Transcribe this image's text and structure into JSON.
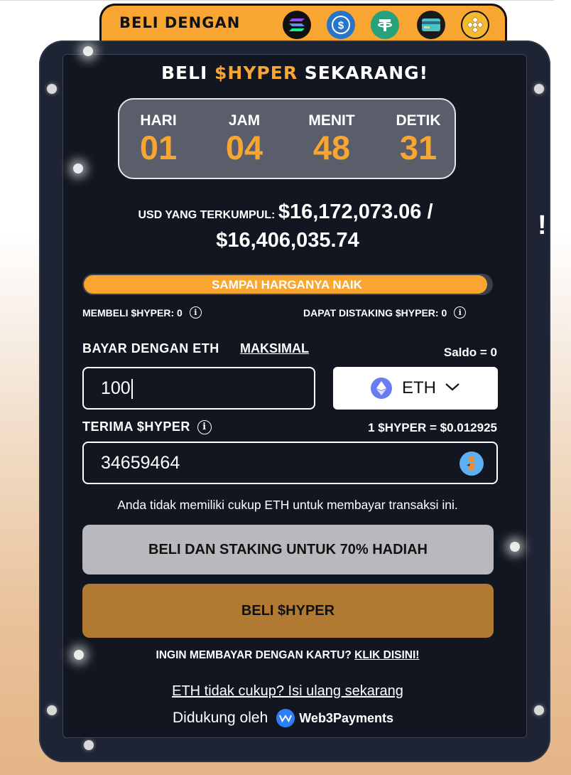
{
  "pay_with": {
    "label": "BELI DENGAN",
    "icons": [
      "solana-icon",
      "usdc-icon",
      "tether-icon",
      "card-icon",
      "bnb-icon"
    ]
  },
  "title": {
    "prefix": "BELI ",
    "token": "$HYPER",
    "suffix": " SEKARANG!"
  },
  "countdown": {
    "units": [
      {
        "label": "HARI",
        "value": "01"
      },
      {
        "label": "JAM",
        "value": "04"
      },
      {
        "label": "MENIT",
        "value": "48"
      },
      {
        "label": "DETIK",
        "value": "31"
      }
    ]
  },
  "raised": {
    "label": "USD YANG TERKUMPUL:",
    "amount": "$16,172,073.06 /",
    "target": "$16,406,035.74",
    "progress_fraction": 0.99
  },
  "progress_label": "SAMPAI HARGANYA NAIK",
  "stats": {
    "bought": "MEMBELI $HYPER: 0",
    "staked": "DAPAT DISTAKING $HYPER: 0"
  },
  "pay": {
    "label": "BAYAR DENGAN ETH",
    "max": "MAKSIMAL",
    "balance": "Saldo = 0",
    "amount": "100",
    "currency": "ETH"
  },
  "receive": {
    "label": "TERIMA $HYPER",
    "rate": "1 $HYPER = $0.012925",
    "amount": "34659464"
  },
  "warning": "Anda tidak memiliki cukup ETH untuk membayar transaksi ini.",
  "buttons": {
    "stake": "BELI DAN STAKING UNTUK 70% HADIAH",
    "buy": "BELI $HYPER"
  },
  "card": {
    "text": "INGIN MEMBAYAR DENGAN KARTU?",
    "link": "KLIK DISINI!"
  },
  "topup": "ETH tidak cukup? Isi ulang sekarang",
  "powered": {
    "text": "Didukung oleh",
    "brand": "Web3Payments"
  },
  "colors": {
    "accent": "#f9a532",
    "panel": "#1e2433",
    "buy_button": "#b07a33",
    "stake_button": "#b9b9bd"
  }
}
